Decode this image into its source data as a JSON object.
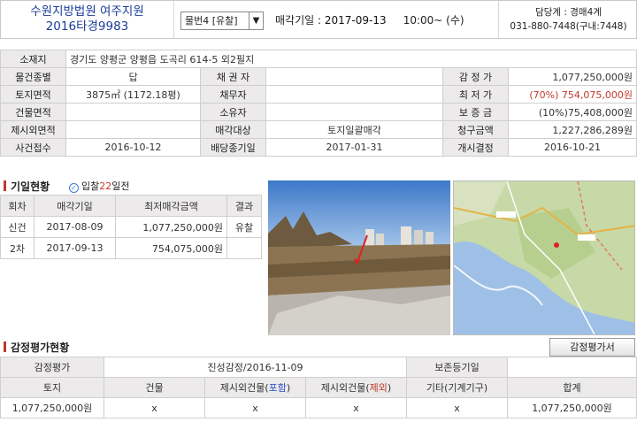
{
  "header": {
    "court": "수원지방법원 여주지원",
    "case_no": "2016타경9983",
    "item_select": "물번4 [유찰]",
    "auction_label": "매각기일",
    "auction_date": "2017-09-13",
    "auction_time": "10:00~ (수)",
    "dept": "담당계 : 경매4계",
    "phone": "031-880-7448(구내:7448)"
  },
  "info": {
    "location_label": "소재지",
    "location": "경기도 양평군 양평읍 도곡리 614-5 외2필지",
    "item_type_label": "물건종별",
    "item_type": "답",
    "creditor_label": "채 권 자",
    "creditor": "",
    "appraisal_label": "감 정 가",
    "appraisal": "1,077,250,000원",
    "land_area_label": "토지면적",
    "land_area": "3875㎡ (1172.18평)",
    "debtor_label": "채무자",
    "debtor": "",
    "min_price_label": "최 저 가",
    "min_price": "(70%) 754,075,000원",
    "building_area_label": "건물면적",
    "building_area": "",
    "owner_label": "소유자",
    "owner": "",
    "deposit_label": "보 증 금",
    "deposit": "(10%)75,408,000원",
    "excluded_area_label": "제시외면적",
    "excluded_area": "",
    "sale_target_label": "매각대상",
    "sale_target": "토지일괄매각",
    "claim_label": "청구금액",
    "claim": "1,227,286,289원",
    "filed_label": "사건접수",
    "filed": "2016-10-12",
    "dividend_label": "배당종기일",
    "dividend": "2017-01-31",
    "start_label": "개시결정",
    "start": "2016-10-21"
  },
  "history": {
    "title": "기일현황",
    "note_prefix": "입찰",
    "note_days": "22",
    "note_suffix": "일전",
    "headers": [
      "회차",
      "매각기일",
      "최저매각금액",
      "결과"
    ],
    "rows": [
      {
        "round": "신건",
        "date": "2017-08-09",
        "amount": "1,077,250,000원",
        "result": "유찰"
      },
      {
        "round": "2차",
        "date": "2017-09-13",
        "amount": "754,075,000원",
        "result": ""
      }
    ]
  },
  "appraisal_section": {
    "title": "감정평가현황",
    "button": "감정평가서",
    "label": "감정평가",
    "eval": "진성감정/2016-11-09",
    "preserve_label": "보존등기일",
    "preserve": "",
    "headers": [
      "토지",
      "건물",
      "제시외건물(",
      "포함",
      ")",
      "제시외건물(",
      "제외",
      ")",
      "기타(기계기구)",
      "합계"
    ],
    "values": {
      "land": "1,077,250,000원",
      "building": "x",
      "incl": "x",
      "excl": "x",
      "other": "x",
      "total": "1,077,250,000원"
    }
  },
  "colors": {
    "label_bg": "#eceaea",
    "court_text": "#1a3c99",
    "accent_red": "#c0392b",
    "blue": "#2a4ec7"
  }
}
